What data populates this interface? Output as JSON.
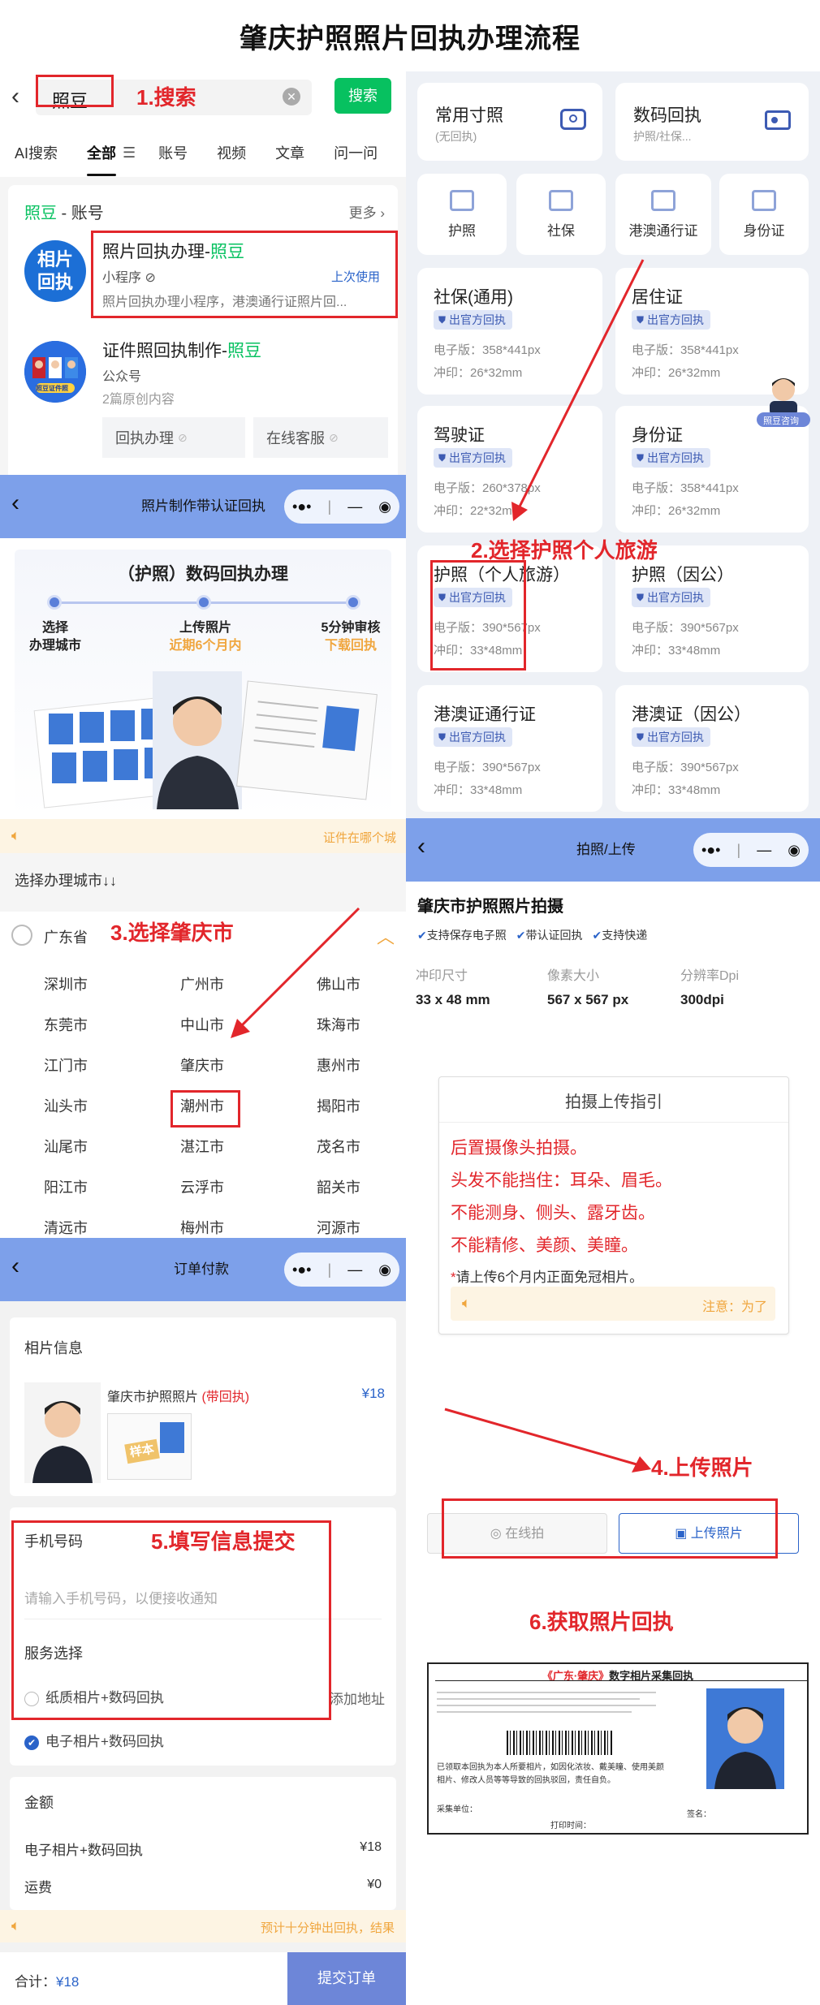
{
  "page_title": "肇庆护照照片回执办理流程",
  "steps": {
    "s1": "1.搜索",
    "s2": "2.选择护照个人旅游",
    "s3": "3.选择肇庆市",
    "s4": "4.上传照片",
    "s5": "5.填写信息提交",
    "s6": "6.获取照片回执"
  },
  "search": {
    "query": "照豆",
    "search_button": "搜索",
    "tabs": [
      "AI搜索",
      "全部",
      "账号",
      "视频",
      "文章",
      "问一问"
    ],
    "account_section_prefix": "照豆",
    "account_section_suffix": " - 账号",
    "more": "更多",
    "result1": {
      "avatar_line1": "相片",
      "avatar_line2": "回执",
      "title_prefix": "照片回执办理-",
      "title_hl": "照豆",
      "type": "小程序",
      "recent": "上次使用",
      "desc": "照片回执办理小程序，港澳通行证照片回..."
    },
    "result2": {
      "avatar_text": "照豆证件照",
      "title_prefix": "证件照回执制作-",
      "title_hl": "照豆",
      "type": "公众号",
      "desc": "2篇原创内容",
      "btn1": "回执办理",
      "btn2": "在线客服"
    }
  },
  "product": {
    "card1_title": "常用寸照",
    "card1_sub": "(无回执)",
    "card2_title": "数码回执",
    "card2_sub": "护照/社保...",
    "icons": [
      "护照",
      "社保",
      "港澳通行证",
      "身份证"
    ],
    "badge": "出官方回执",
    "support_label": "照豆咨询",
    "items": [
      {
        "name": "社保(通用)",
        "elec": "电子版：358*441px",
        "print": "冲印：26*32mm"
      },
      {
        "name": "居住证",
        "elec": "电子版：358*441px",
        "print": "冲印：26*32mm"
      },
      {
        "name": "驾驶证",
        "elec": "电子版：260*378px",
        "print": "冲印：22*32mm"
      },
      {
        "name": "身份证",
        "elec": "电子版：358*441px",
        "print": "冲印：26*32mm"
      },
      {
        "name": "护照（个人旅游）",
        "elec": "电子版：390*567px",
        "print": "冲印：33*48mm"
      },
      {
        "name": "护照（因公）",
        "elec": "电子版：390*567px",
        "print": "冲印：33*48mm"
      },
      {
        "name": "港澳证通行证",
        "elec": "电子版：390*567px",
        "print": "冲印：33*48mm"
      },
      {
        "name": "港澳证（因公）",
        "elec": "电子版：390*567px",
        "print": "冲印：33*48mm"
      }
    ]
  },
  "process": {
    "nav_title": "照片制作带认证回执",
    "banner_title": "（护照）数码回执办理",
    "steps": [
      {
        "l1": "选择",
        "l2": "办理城市"
      },
      {
        "l1": "上传照片",
        "l2": "近期6个月内"
      },
      {
        "l1": "5分钟审核",
        "l2": "下载回执"
      }
    ],
    "notice": "证件在哪个城",
    "city_title": "选择办理城市↓↓",
    "province": "广东省",
    "cities": [
      "深圳市",
      "广州市",
      "佛山市",
      "东莞市",
      "中山市",
      "珠海市",
      "江门市",
      "肇庆市",
      "惠州市",
      "汕头市",
      "潮州市",
      "揭阳市",
      "汕尾市",
      "湛江市",
      "茂名市",
      "阳江市",
      "云浮市",
      "韶关市",
      "清远市",
      "梅州市",
      "河源市"
    ]
  },
  "upload": {
    "nav_title": "拍照/上传",
    "title": "肇庆市护照照片拍摄",
    "features": [
      "支持保存电子照",
      "带认证回执",
      "支持快递"
    ],
    "spec_labels": [
      "冲印尺寸",
      "像素大小",
      "分辨率Dpi"
    ],
    "spec_values": [
      "33 x 48 mm",
      "567 x 567 px",
      "300dpi"
    ],
    "guide_title": "拍摄上传指引",
    "guide_lines": [
      "后置摄像头拍摄。",
      "头发不能挡住：耳朵、眉毛。",
      "不能测身、侧头、露牙齿。",
      "不能精修、美颜、美瞳。"
    ],
    "guide_note_star": "*",
    "guide_note": "请上传6个月内正面免冠相片。",
    "guide_notice": "注意：为了",
    "btn_shoot": "在线拍",
    "btn_upload": "上传照片"
  },
  "order": {
    "nav_title": "订单付款",
    "info_title": "相片信息",
    "product_name": "肇庆市护照照片",
    "product_tag": "(带回执)",
    "price": "¥18",
    "sample_stamp": "样本",
    "phone_title": "手机号码",
    "phone_placeholder": "请输入手机号码，以便接收通知",
    "service_title": "服务选择",
    "option1": "纸质相片+数码回执",
    "add_address": "添加地址",
    "option2": "电子相片+数码回执",
    "amount_title": "金额",
    "line1_label": "电子相片+数码回执",
    "line1_value": "¥18",
    "line2_label": "运费",
    "line2_value": "¥0",
    "notice": "预计十分钟出回执，结果",
    "total_label": "合计：",
    "total_value": "¥18",
    "submit": "提交订单"
  },
  "receipt": {
    "title_hl": "《广东·肇庆》",
    "title": "数字相片采集回执",
    "line1": "已领取本回执为本人所要相片，如因化浓妆、戴美瞳、使用美颜",
    "line2": "相片、修改人员等等导致的回执驳回，责任自负。",
    "label_no": "采集单位：",
    "label_date": "打印时间：",
    "label_sign": "签名："
  },
  "colors": {
    "accent_red": "#e2262b",
    "brand_green": "#07c160",
    "nav_blue": "#7da0ea",
    "primary_blue": "#3d5bb3",
    "notice_orange": "#f0a63e"
  }
}
